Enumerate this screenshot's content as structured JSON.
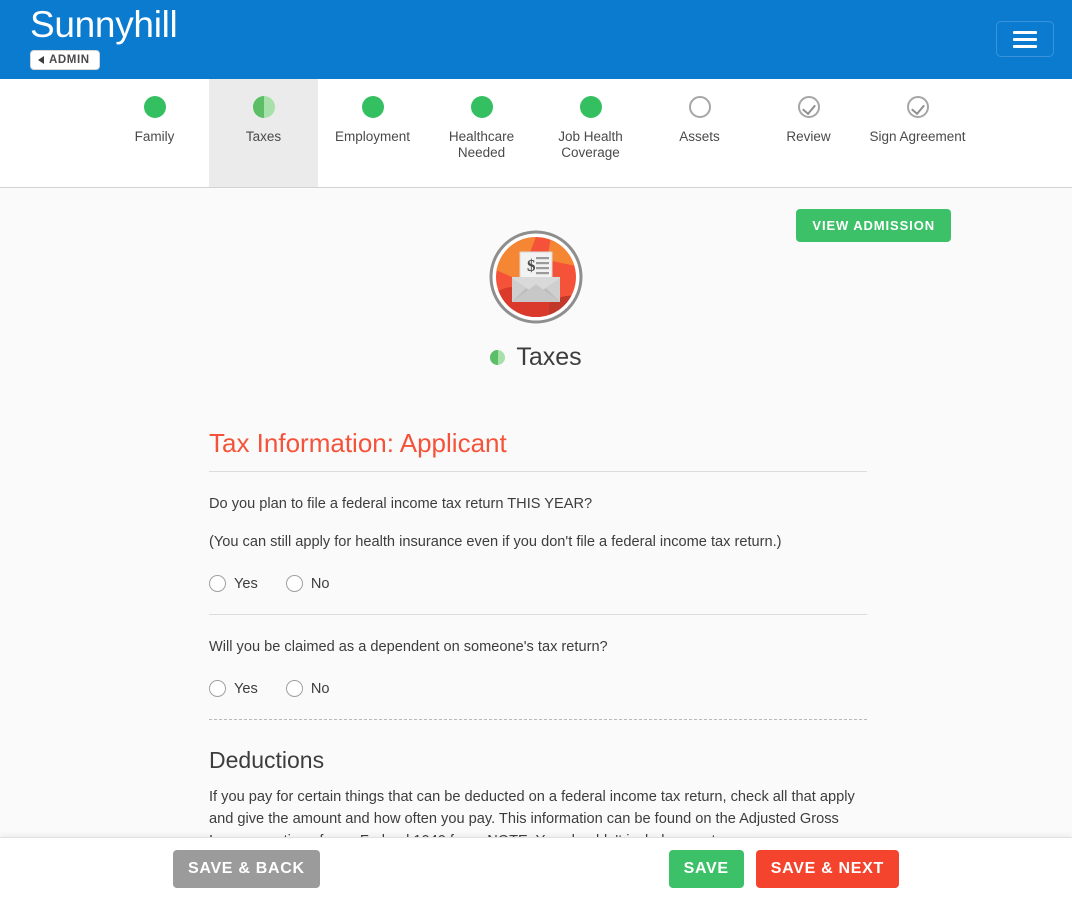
{
  "header": {
    "brand": "Sunnyhill",
    "admin_button": "ADMIN",
    "menu_icon": "hamburger-icon",
    "background_color": "#0b7bd0"
  },
  "steps": [
    {
      "label": "Family",
      "status": "complete",
      "icon": "filled-circle-icon",
      "active": false
    },
    {
      "label": "Taxes",
      "status": "in-progress",
      "icon": "half-filled-circle-icon",
      "active": true
    },
    {
      "label": "Employment",
      "status": "complete",
      "icon": "filled-circle-icon",
      "active": false
    },
    {
      "label": "Healthcare Needed",
      "status": "complete",
      "icon": "filled-circle-icon",
      "active": false
    },
    {
      "label": "Job Health Coverage",
      "status": "complete",
      "icon": "filled-circle-icon",
      "active": false
    },
    {
      "label": "Assets",
      "status": "empty",
      "icon": "empty-circle-icon",
      "active": false
    },
    {
      "label": "Review",
      "status": "check",
      "icon": "check-circle-icon",
      "active": false
    },
    {
      "label": "Sign Agreement",
      "status": "check",
      "icon": "check-circle-icon",
      "active": false
    }
  ],
  "main": {
    "view_admission_label": "VIEW ADMISSION",
    "hero_icon": "tax-envelope-icon",
    "page_title": "Taxes",
    "page_title_icon": "half-filled-circle-icon",
    "section_title": "Tax Information: Applicant",
    "questions": [
      {
        "text": "Do you plan to file a federal income tax return THIS YEAR?",
        "note": "(You can still apply for health insurance even if you don't file a federal income tax return.)",
        "options": [
          {
            "label": "Yes",
            "selected": false
          },
          {
            "label": "No",
            "selected": false
          }
        ]
      },
      {
        "text": "Will you be claimed as a dependent on someone's tax return?",
        "options": [
          {
            "label": "Yes",
            "selected": false
          },
          {
            "label": "No",
            "selected": false
          }
        ]
      }
    ],
    "deductions": {
      "heading": "Deductions",
      "body": "If you pay for certain things that can be deducted on a federal income tax return, check all that apply and give the amount and how often you pay. This information can be found on the Adjusted Gross Income section of your Federal 1040 form. NOTE: You shouldn't include a cost"
    }
  },
  "action_bar": {
    "save_back": "SAVE & BACK",
    "save": "SAVE",
    "save_next": "SAVE & NEXT"
  },
  "colors": {
    "brand_blue": "#0b7bd0",
    "green": "#3cc168",
    "red": "#f4442e",
    "section_title": "#f4533a",
    "gray": "#9b9b9b"
  }
}
